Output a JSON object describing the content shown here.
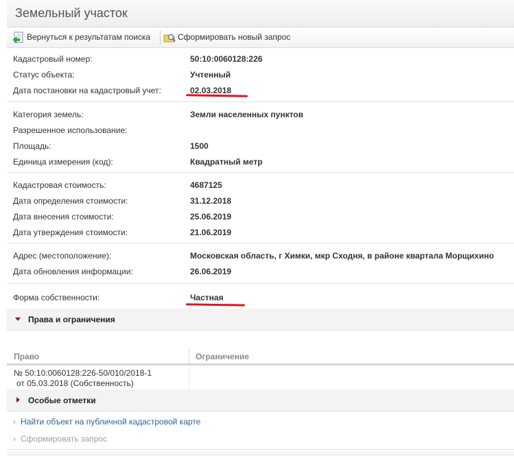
{
  "window": {
    "title": "Земельный участок"
  },
  "toolbar": {
    "back_label": "Вернуться к результатам поиска",
    "new_query_label": "Сформировать новый запрос"
  },
  "groups": [
    [
      {
        "label": "Кадастровый номер:",
        "value": "50:10:0060128:226"
      },
      {
        "label": "Статус объекта:",
        "value": "Учтенный"
      },
      {
        "label": "Дата постановки на кадастровый учет:",
        "value": "02.03.2018"
      }
    ],
    [
      {
        "label": "Категория земель:",
        "value": "Земли населенных пунктов"
      },
      {
        "label": "Разрешенное использование:",
        "value": ""
      },
      {
        "label": "Площадь:",
        "value": "1500"
      },
      {
        "label": "Единица измерения (код):",
        "value": "Квадратный метр"
      }
    ],
    [
      {
        "label": "Кадастровая стоимость:",
        "value": "4687125"
      },
      {
        "label": "Дата определения стоимости:",
        "value": "31.12.2018"
      },
      {
        "label": "Дата внесения стоимости:",
        "value": "25.06.2019"
      },
      {
        "label": "Дата утверждения стоимости:",
        "value": "21.06.2019"
      }
    ],
    [
      {
        "label": "Адрес (местоположение):",
        "value": "Московская область, г Химки, мкр Сходня, в районе квартала Морщихино"
      },
      {
        "label": "Дата обновления информации:",
        "value": "26.06.2019"
      }
    ],
    [
      {
        "label": "Форма собственности:",
        "value": "Частная"
      }
    ]
  ],
  "rights_section": {
    "title": "Права и ограничения",
    "columns": [
      "Право",
      "Ограничение"
    ],
    "rows": [
      {
        "right_line1": "№ 50:10:0060128:226-50/010/2018-1",
        "right_line2": "от 05.03.2018  (Собственность)",
        "restriction": ""
      }
    ]
  },
  "special_section": {
    "title": "Особые отметки"
  },
  "links": {
    "map": "Найти объект на публичной кадастровой карте",
    "request": "Сформировать запрос"
  },
  "colors": {
    "link_active": "#2a6496",
    "link_disabled": "#a0a0a0",
    "highlight": "#e0141e",
    "section_arrow": "#8b1a1a"
  }
}
